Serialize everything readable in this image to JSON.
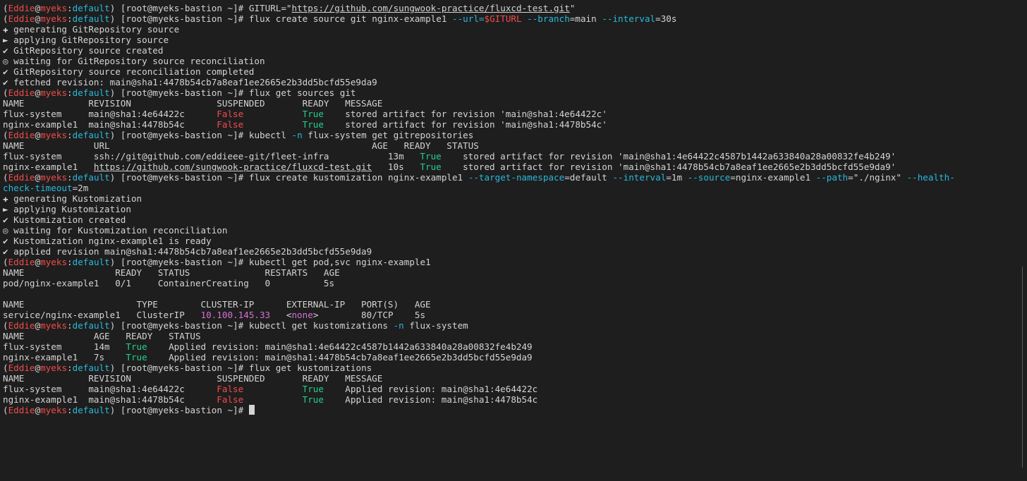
{
  "prompt": {
    "user": "Eddie",
    "host": "myeks",
    "ns": "default",
    "rest": "[root@myeks-bastion ~]# "
  },
  "lines": [
    {
      "kind": "cmd",
      "cmd": "GITURL=\"",
      "tail": "https://github.com/sungwook-practice/fluxcd-test.git",
      "end": "\""
    },
    {
      "kind": "cmd",
      "cmd": "flux create source git nginx-example1 ",
      "opt1": "--url=",
      "var1": "$GITURL",
      "opt2": " --branch",
      "t2": "=main ",
      "opt3": "--interval",
      "t3": "=30s"
    },
    {
      "kind": "out",
      "text": "✚ generating GitRepository source"
    },
    {
      "kind": "out",
      "text": "► applying GitRepository source"
    },
    {
      "kind": "out",
      "text": "✔ GitRepository source created"
    },
    {
      "kind": "out",
      "text": "◎ waiting for GitRepository source reconciliation"
    },
    {
      "kind": "out",
      "text": "✔ GitRepository source reconciliation completed"
    },
    {
      "kind": "out",
      "text": "✔ fetched revision: main@sha1:4478b54cb7a8eaf1ee2665e2b3dd5bcfd55e9da9"
    },
    {
      "kind": "cmd",
      "cmd": "flux get sources git"
    },
    {
      "kind": "out",
      "text": "NAME            REVISION                SUSPENDED       READY   MESSAGE"
    },
    {
      "kind": "row5",
      "a": "flux-system     main@sha1:4e64422c      ",
      "b": "False",
      "c": "           ",
      "d": "True",
      "e": "    stored artifact for revision 'main@sha1:4e64422c'"
    },
    {
      "kind": "row5",
      "a": "nginx-example1  main@sha1:4478b54c      ",
      "b": "False",
      "c": "           ",
      "d": "True",
      "e": "    stored artifact for revision 'main@sha1:4478b54c'"
    },
    {
      "kind": "cmd",
      "cmd": "kubectl ",
      "opt1": "-n",
      "t1": " flux-system get gitrepositories"
    },
    {
      "kind": "out",
      "text": "NAME             URL                                                 AGE   READY   STATUS"
    },
    {
      "kind": "row3",
      "a": "flux-system      ssh://git@github.com/eddieee-git/fleet-infra           13m   ",
      "b": "True",
      "c": "    stored artifact for revision 'main@sha1:4e64422c4587b1442a633840a28a00832fe4b249'"
    },
    {
      "kind": "rowurl",
      "a": "nginx-example1   ",
      "url": "https://github.com/sungwook-practice/fluxcd-test.git",
      "a2": "   10s   ",
      "b": "True",
      "c": "    stored artifact for revision 'main@sha1:4478b54cb7a8eaf1ee2665e2b3dd5bcfd55e9da9'"
    },
    {
      "kind": "cmd",
      "cmd": "flux create kustomization nginx-example1 ",
      "opt1": "--target-namespace",
      "t1": "=default ",
      "opt2": "--interval",
      "t2": "=1m ",
      "opt3": "--source",
      "t3": "=nginx-example1 ",
      "opt4": "--path",
      "t4": "=\"./nginx\" ",
      "opt5": "--health-"
    },
    {
      "kind": "wrap",
      "opt": "check-timeout",
      "t": "=2m"
    },
    {
      "kind": "out",
      "text": "✚ generating Kustomization"
    },
    {
      "kind": "out",
      "text": "► applying Kustomization"
    },
    {
      "kind": "out",
      "text": "✔ Kustomization created"
    },
    {
      "kind": "out",
      "text": "◎ waiting for Kustomization reconciliation"
    },
    {
      "kind": "out",
      "text": "✔ Kustomization nginx-example1 is ready"
    },
    {
      "kind": "out",
      "text": "✔ applied revision main@sha1:4478b54cb7a8eaf1ee2665e2b3dd5bcfd55e9da9"
    },
    {
      "kind": "cmd",
      "cmd": "kubectl get pod,svc nginx-example1"
    },
    {
      "kind": "out",
      "text": "NAME                 READY   STATUS              RESTARTS   AGE"
    },
    {
      "kind": "out",
      "text": "pod/nginx-example1   0/1     ContainerCreating   0          5s"
    },
    {
      "kind": "out",
      "text": ""
    },
    {
      "kind": "out",
      "text": "NAME                     TYPE        CLUSTER-IP      EXTERNAL-IP   PORT(S)   AGE"
    },
    {
      "kind": "rowsvc",
      "a": "service/nginx-example1   ClusterIP   ",
      "ip": "10.100.145.33",
      "b": "   <",
      "none": "none",
      "c": ">        80/TCP    5s"
    },
    {
      "kind": "cmd",
      "cmd": "kubectl get kustomizations ",
      "opt1": "-n",
      "t1": " flux-system"
    },
    {
      "kind": "out",
      "text": "NAME             AGE   READY   STATUS"
    },
    {
      "kind": "row3",
      "a": "flux-system      14m   ",
      "b": "True",
      "c": "    Applied revision: main@sha1:4e64422c4587b1442a633840a28a00832fe4b249"
    },
    {
      "kind": "row3",
      "a": "nginx-example1   7s    ",
      "b": "True",
      "c": "    Applied revision: main@sha1:4478b54cb7a8eaf1ee2665e2b3dd5bcfd55e9da9"
    },
    {
      "kind": "cmd",
      "cmd": "flux get kustomizations"
    },
    {
      "kind": "out",
      "text": "NAME            REVISION                SUSPENDED       READY   MESSAGE"
    },
    {
      "kind": "row5",
      "a": "flux-system     main@sha1:4e64422c      ",
      "b": "False",
      "c": "           ",
      "d": "True",
      "e": "    Applied revision: main@sha1:4e64422c"
    },
    {
      "kind": "row5",
      "a": "nginx-example1  main@sha1:4478b54c      ",
      "b": "False",
      "c": "           ",
      "d": "True",
      "e": "    Applied revision: main@sha1:4478b54c"
    },
    {
      "kind": "cmd",
      "cmd": "",
      "cursor": true
    }
  ]
}
